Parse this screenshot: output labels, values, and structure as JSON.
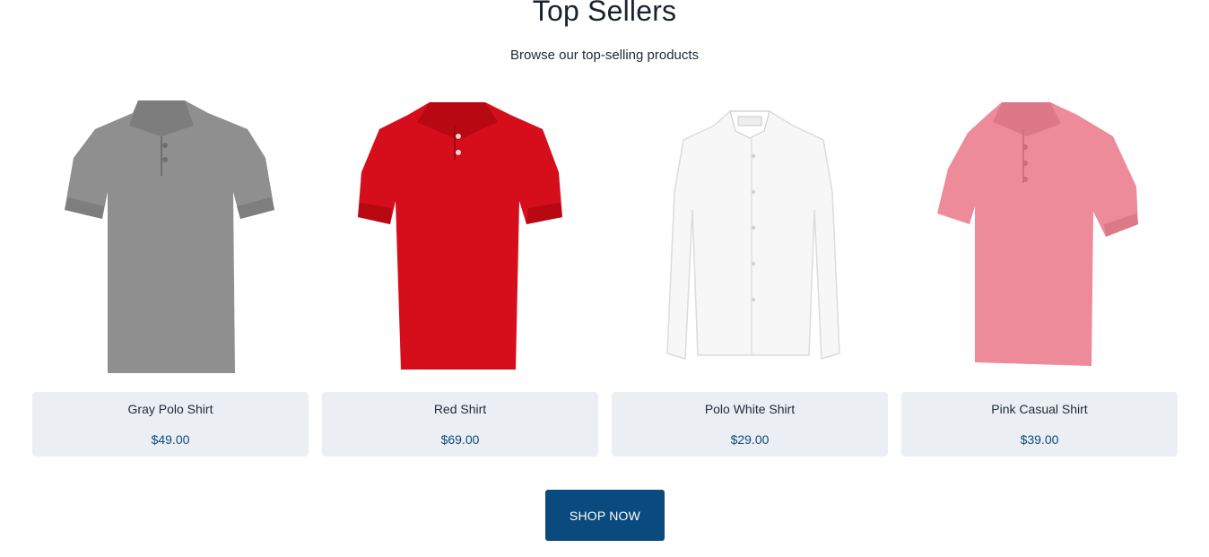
{
  "section": {
    "title": "Top Sellers",
    "subtitle": "Browse our top-selling products"
  },
  "products": [
    {
      "name": "Gray Polo Shirt",
      "price": "$49.00",
      "image_icon": "gray-polo-shirt-image",
      "color": "#8e8e8e"
    },
    {
      "name": "Red Shirt",
      "price": "$69.00",
      "image_icon": "red-polo-shirt-image",
      "color": "#d60d1a"
    },
    {
      "name": "Polo White Shirt",
      "price": "$29.00",
      "image_icon": "white-dress-shirt-image",
      "color": "#f6f6f6"
    },
    {
      "name": "Pink Casual Shirt",
      "price": "$39.00",
      "image_icon": "pink-polo-shirt-image",
      "color": "#ec8a9a"
    }
  ],
  "cta": {
    "label": "SHOP NOW"
  },
  "colors": {
    "card_background": "#ebeff4",
    "price_text": "#0b4a7a",
    "button_background": "#0b4a7e"
  }
}
